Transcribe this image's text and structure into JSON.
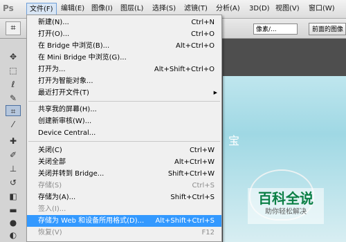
{
  "menubar": {
    "logo": "Ps",
    "items": [
      "文件(F)",
      "编辑(E)",
      "图像(I)",
      "图层(L)",
      "选择(S)",
      "滤镜(T)",
      "分析(A)",
      "3D(D)",
      "视图(V)",
      "窗口(W)"
    ]
  },
  "options": {
    "unit": "像素/...",
    "front_image": "前面的图像"
  },
  "document": {
    "partial_text": "宝"
  },
  "watermark": {
    "title": "百科全说",
    "subtitle": "助你轻松解决"
  },
  "file_menu": {
    "items": [
      {
        "label": "新建(N)...",
        "shortcut": "Ctrl+N",
        "enabled": true
      },
      {
        "label": "打开(O)...",
        "shortcut": "Ctrl+O",
        "enabled": true
      },
      {
        "label": "在 Bridge 中浏览(B)...",
        "shortcut": "Alt+Ctrl+O",
        "enabled": true
      },
      {
        "label": "在 Mini Bridge 中浏览(G)...",
        "shortcut": "",
        "enabled": true
      },
      {
        "label": "打开为...",
        "shortcut": "Alt+Shift+Ctrl+O",
        "enabled": true
      },
      {
        "label": "打开为智能对象...",
        "shortcut": "",
        "enabled": true
      },
      {
        "label": "最近打开文件(T)",
        "shortcut": "",
        "enabled": true,
        "submenu": true
      },
      {
        "label": "共享我的屏幕(H)...",
        "shortcut": "",
        "enabled": true
      },
      {
        "label": "创建新审核(W)...",
        "shortcut": "",
        "enabled": true
      },
      {
        "label": "Device Central...",
        "shortcut": "",
        "enabled": true
      },
      {
        "label": "关闭(C)",
        "shortcut": "Ctrl+W",
        "enabled": true
      },
      {
        "label": "关闭全部",
        "shortcut": "Alt+Ctrl+W",
        "enabled": true
      },
      {
        "label": "关闭并转到 Bridge...",
        "shortcut": "Shift+Ctrl+W",
        "enabled": true
      },
      {
        "label": "存储(S)",
        "shortcut": "Ctrl+S",
        "enabled": false
      },
      {
        "label": "存储为(A)...",
        "shortcut": "Shift+Ctrl+S",
        "enabled": true
      },
      {
        "label": "签入(I)...",
        "shortcut": "",
        "enabled": false
      },
      {
        "label": "存储为 Web 和设备所用格式(D)...",
        "shortcut": "Alt+Shift+Ctrl+S",
        "enabled": true,
        "highlighted": true
      },
      {
        "label": "恢复(V)",
        "shortcut": "F12",
        "enabled": false
      }
    ]
  },
  "colors": {
    "highlight": "#3399ff",
    "menu_bg": "#f0f0f0",
    "watermark_green": "#0a7f45"
  }
}
